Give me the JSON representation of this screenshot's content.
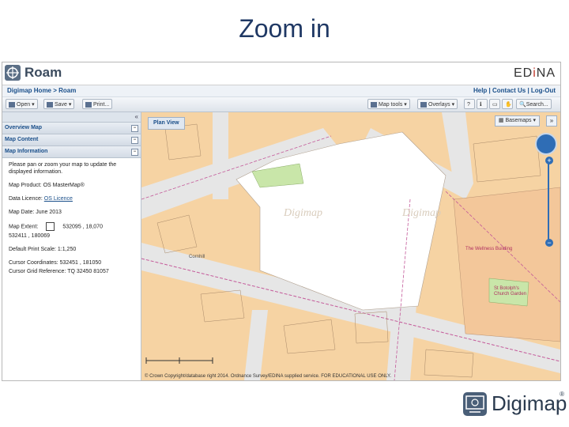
{
  "slide": {
    "title": "Zoom in"
  },
  "app": {
    "name": "Roam",
    "provider_prefix": "ED",
    "provider_i": "i",
    "provider_suffix": "NA",
    "breadcrumb": "Digimap Home > Roam",
    "toplinks": "Help | Contact Us | Log-Out"
  },
  "toolbar": {
    "open": "Open",
    "save": "Save",
    "print": "Print...",
    "map_tools": "Map tools",
    "overlays": "Overlays",
    "search": "Search..."
  },
  "sidebar": {
    "collapse_glyph": "«",
    "panels": [
      {
        "label": "Overview Map"
      },
      {
        "label": "Map Content"
      },
      {
        "label": "Map Information"
      }
    ],
    "info": {
      "intro": "Please pan or zoom your map to update the displayed information.",
      "product_label": "Map Product:",
      "product_value": "OS MasterMap®",
      "licence_label": "Data Licence:",
      "licence_value": "OS Licence",
      "date_label": "Map Date:",
      "date_value": "June 2013",
      "extent_label": "Map Extent:",
      "extent_top": "532095 , 18,070",
      "extent_bottom": "532411 , 180069",
      "scale_label": "Default Print Scale:",
      "scale_value": "1:1,250",
      "coords_label": "Cursor Coordinates:",
      "coords_value": "532451 , 181050",
      "gridref_label": "Cursor Grid Reference:",
      "gridref_value": "TQ 32450 81057"
    }
  },
  "map": {
    "plan_view": "Plan View",
    "basemaps": "Basemaps",
    "collapse_glyph": "»",
    "zoom_in": "+",
    "zoom_out": "−",
    "watermark": "Digimap",
    "label_building": "The Wellness Building",
    "label_garden": "St Botolph's Church Garden",
    "label_rail": "Cornhill",
    "copyright": "© Crown Copyright/database right 2014. Ordnance Survey/EDINA supplied service. FOR EDUCATIONAL USE ONLY."
  },
  "brand": {
    "name": "Digimap",
    "reg": "®"
  },
  "colors": {
    "title": "#1f3864",
    "map_base": "#f6d3a3",
    "road": "#e6e6e6",
    "building": "#ffffff",
    "accent": "#2f6db5",
    "pink_line": "#c45a9a"
  }
}
